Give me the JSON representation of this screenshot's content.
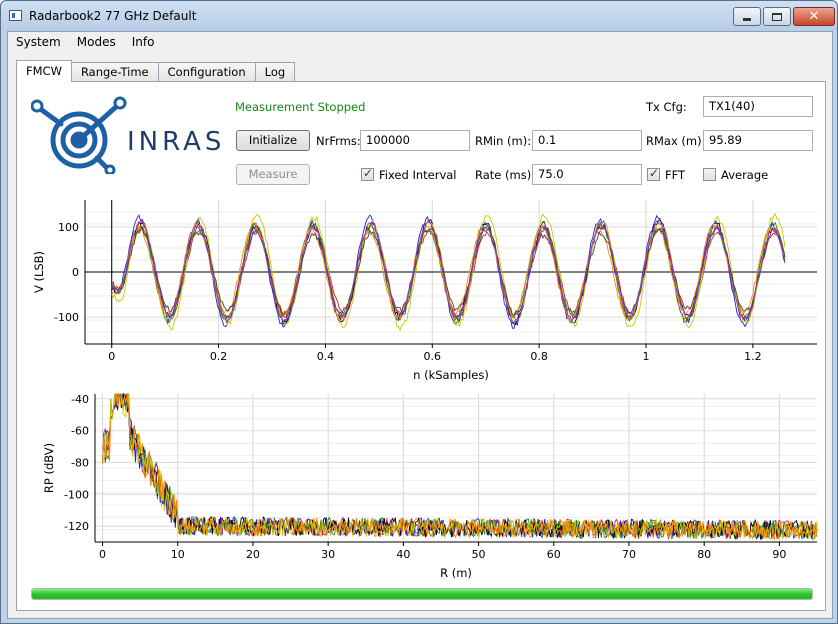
{
  "window": {
    "title": "Radarbook2 77 GHz Default"
  },
  "menu": [
    "System",
    "Modes",
    "Info"
  ],
  "tabs": [
    "FMCW",
    "Range-Time",
    "Configuration",
    "Log"
  ],
  "logo": {
    "text": "INRAS",
    "color": "#1e5fa6"
  },
  "status": {
    "text": "Measurement Stopped",
    "color": "#118811"
  },
  "controls": {
    "initialize_label": "Initialize",
    "measure_label": "Measure",
    "nrfrms_label": "NrFrms:",
    "nrfrms_value": "100000",
    "rmin_label": "RMin (m):",
    "rmin_value": "0.1",
    "rmax_label": "RMax (m):",
    "rmax_value": "95.89",
    "txcfg_label": "Tx Cfg:",
    "txcfg_value": "TX1(40)",
    "fixed_interval_label": "Fixed Interval",
    "fixed_interval_checked": true,
    "rate_label": "Rate (ms):",
    "rate_value": "75.0",
    "fft_label": "FFT",
    "fft_checked": true,
    "average_label": "Average",
    "average_checked": false
  },
  "progress": {
    "value": 1.0,
    "color": "#2fc52f"
  },
  "chart_data": [
    {
      "type": "line",
      "title": "",
      "xlabel": "n (kSamples)",
      "ylabel": "V (LSB)",
      "xlim": [
        -0.05,
        1.32
      ],
      "ylim": [
        -160,
        160
      ],
      "xticks": [
        0,
        0.2,
        0.4,
        0.6,
        0.8,
        1,
        1.2
      ],
      "xtick_labels": [
        "0",
        "0.2",
        "0.4",
        "0.6",
        "0.8",
        "1",
        "1.2"
      ],
      "yticks": [
        -100,
        0,
        100
      ],
      "ytick_labels": [
        "-100",
        "0",
        "100"
      ],
      "grid": true,
      "series_desc": "8 channel sinusoids, ~11.7 cycles over 0–1.26 kSamples, amplitude ~100",
      "series": [
        {
          "color": "#000000",
          "amplitude": 105,
          "phase": 0.0
        },
        {
          "color": "#2222cc",
          "amplitude": 112,
          "phase": 0.1
        },
        {
          "color": "#cc2222",
          "amplitude": 95,
          "phase": -0.08
        },
        {
          "color": "#228822",
          "amplitude": 100,
          "phase": 0.05
        },
        {
          "color": "#c8c800",
          "amplitude": 118,
          "phase": -0.12
        },
        {
          "color": "#ff8800",
          "amplitude": 98,
          "phase": 0.15
        },
        {
          "color": "#444444",
          "amplitude": 90,
          "phase": -0.04
        },
        {
          "color": "#9933cc",
          "amplitude": 102,
          "phase": 0.02
        }
      ],
      "x_end": 1.26,
      "cycles": 11.7
    },
    {
      "type": "line",
      "title": "",
      "xlabel": "R (m)",
      "ylabel": "RP (dBV)",
      "xlim": [
        -1,
        95
      ],
      "ylim": [
        -130,
        -37
      ],
      "xticks": [
        0,
        10,
        20,
        30,
        40,
        50,
        60,
        70,
        80,
        90
      ],
      "xtick_labels": [
        "0",
        "10",
        "20",
        "30",
        "40",
        "50",
        "60",
        "70",
        "80",
        "90"
      ],
      "yticks": [
        -120,
        -100,
        -80,
        -60,
        -40
      ],
      "ytick_labels": [
        "-120",
        "-100",
        "-80",
        "-60",
        "-40"
      ],
      "grid": true,
      "peak": {
        "x": 2.3,
        "y": -42
      },
      "noise_floor": -122,
      "series": [
        {
          "color": "#cc2222"
        },
        {
          "color": "#2222cc"
        },
        {
          "color": "#228822"
        },
        {
          "color": "#000000"
        },
        {
          "color": "#c8c800"
        },
        {
          "color": "#ff8800"
        }
      ]
    }
  ]
}
